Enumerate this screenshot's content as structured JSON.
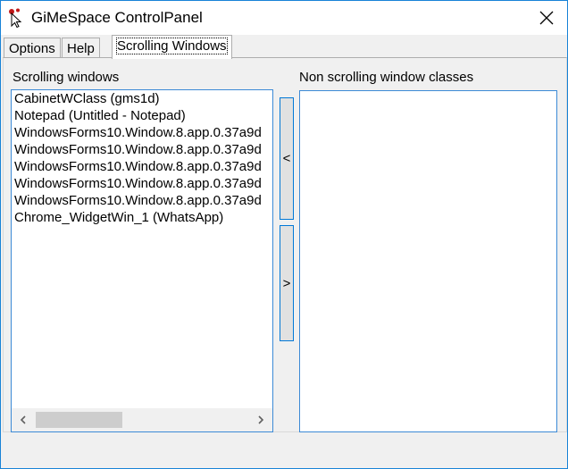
{
  "window": {
    "title": "GiMeSpace ControlPanel",
    "accent": "#0078d7"
  },
  "tabs": [
    {
      "label": "Options",
      "active": false
    },
    {
      "label": "Help",
      "active": false
    },
    {
      "label": "Scrolling Windows",
      "active": true
    }
  ],
  "left_panel": {
    "label": "Scrolling windows",
    "items": [
      "CabinetWClass (gms1d)",
      "Notepad (Untitled - Notepad)",
      "WindowsForms10.Window.8.app.0.37a9d",
      "WindowsForms10.Window.8.app.0.37a9d",
      "WindowsForms10.Window.8.app.0.37a9d",
      "WindowsForms10.Window.8.app.0.37a9d",
      "WindowsForms10.Window.8.app.0.37a9d",
      "Chrome_WidgetWin_1 (WhatsApp)"
    ]
  },
  "right_panel": {
    "label": "Non scrolling window classes",
    "items": []
  },
  "buttons": {
    "move_left": "<",
    "move_right": ">"
  },
  "icons": {
    "app": "gimespace-cursor-icon",
    "close": "close-icon",
    "scroll_left": "chevron-left-icon",
    "scroll_right": "chevron-right-icon"
  }
}
